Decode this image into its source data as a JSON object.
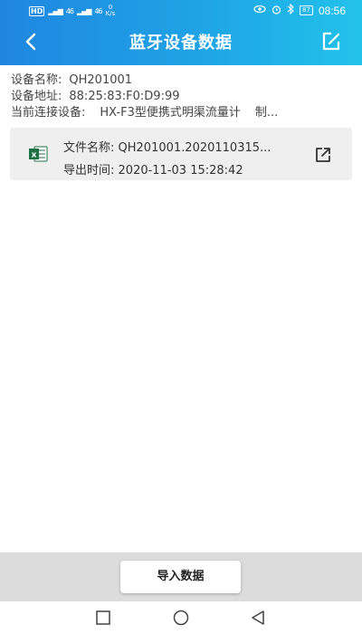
{
  "status_bar": {
    "hd_label": "HD",
    "sim1": "46",
    "sim2": "46",
    "net_speed_value": "0",
    "net_speed_unit": "K/s",
    "battery": "87",
    "time": "08:56"
  },
  "header": {
    "title": "蓝牙设备数据"
  },
  "device_info": {
    "name_label": "设备名称:",
    "name_value": "QH201001",
    "address_label": "设备地址:",
    "address_value": "88:25:83:F0:D9:99",
    "connected_label": "当前连接设备:",
    "connected_value": "HX-F3型便携式明渠流量计",
    "connected_extra": "制..."
  },
  "files": [
    {
      "name_label": "文件名称:",
      "name_value": "QH201001.2020110315...",
      "time_label": "导出时间:",
      "time_value": "2020-11-03 15:28:42"
    }
  ],
  "footer": {
    "import_label": "导入数据"
  },
  "colors": {
    "header_start": "#1f86e0",
    "header_end": "#22c3ea",
    "card_bg": "#efefef",
    "excel_green": "#1e7145"
  }
}
